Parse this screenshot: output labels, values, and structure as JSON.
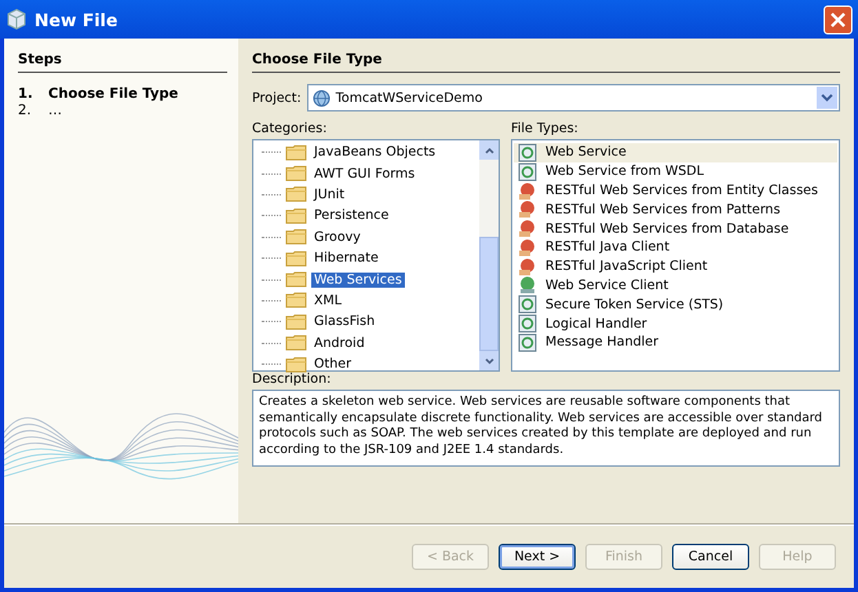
{
  "window": {
    "title": "New File"
  },
  "steps": {
    "title": "Steps",
    "items": [
      {
        "number": "1.",
        "label": "Choose File Type",
        "selected": true
      },
      {
        "number": "2.",
        "label": "…",
        "selected": false
      }
    ]
  },
  "panel": {
    "title": "Choose File Type"
  },
  "project": {
    "label": "Project:",
    "value": "TomcatWServiceDemo"
  },
  "categories": {
    "label": "Categories:",
    "items": [
      {
        "label": "JavaBeans Objects",
        "selected": false
      },
      {
        "label": "AWT GUI Forms",
        "selected": false
      },
      {
        "label": "JUnit",
        "selected": false
      },
      {
        "label": "Persistence",
        "selected": false
      },
      {
        "label": "Groovy",
        "selected": false
      },
      {
        "label": "Hibernate",
        "selected": false
      },
      {
        "label": "Web Services",
        "selected": true
      },
      {
        "label": "XML",
        "selected": false
      },
      {
        "label": "GlassFish",
        "selected": false
      },
      {
        "label": "Android",
        "selected": false
      },
      {
        "label": "Other",
        "selected": false
      }
    ]
  },
  "file_types": {
    "label": "File Types:",
    "items": [
      {
        "label": "Web Service",
        "kind": "service",
        "selected": true
      },
      {
        "label": "Web Service from WSDL",
        "kind": "service",
        "selected": false
      },
      {
        "label": "RESTful Web Services from Entity Classes",
        "kind": "restful",
        "selected": false
      },
      {
        "label": "RESTful Web Services from Patterns",
        "kind": "restful",
        "selected": false
      },
      {
        "label": "RESTful Web Services from Database",
        "kind": "restful",
        "selected": false
      },
      {
        "label": "RESTful Java Client",
        "kind": "restful",
        "selected": false
      },
      {
        "label": "RESTful JavaScript Client",
        "kind": "restful",
        "selected": false
      },
      {
        "label": "Web Service Client",
        "kind": "client",
        "selected": false
      },
      {
        "label": "Secure Token Service (STS)",
        "kind": "service",
        "selected": false
      },
      {
        "label": "Logical Handler",
        "kind": "service",
        "selected": false
      },
      {
        "label": "Message Handler",
        "kind": "service",
        "selected": false
      }
    ]
  },
  "description": {
    "label": "Description:",
    "text": "Creates a skeleton web service. Web services are reusable software components that semantically encapsulate discrete functionality. Web services are accessible over standard protocols such as SOAP. The web services created by this template are deployed and run according to the JSR-109 and J2EE 1.4 standards."
  },
  "buttons": [
    {
      "label": "< Back",
      "disabled": true,
      "default": false
    },
    {
      "label": "Next >",
      "disabled": false,
      "default": true
    },
    {
      "label": "Finish",
      "disabled": true,
      "default": false
    },
    {
      "label": "Cancel",
      "disabled": false,
      "default": false
    },
    {
      "label": "Help",
      "disabled": true,
      "default": false
    }
  ]
}
